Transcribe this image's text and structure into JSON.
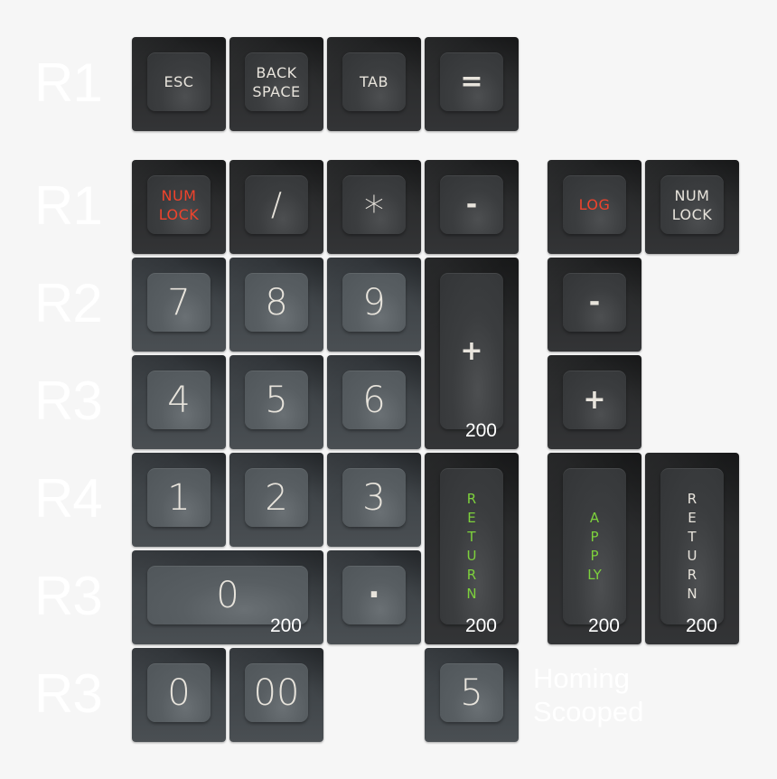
{
  "row_labels": [
    "R1",
    "R1",
    "R2",
    "R3",
    "R4",
    "R3",
    "R3"
  ],
  "colors": {
    "background": "#f6f6f6",
    "legend_default": "#e8e4dc",
    "legend_red": "#f0432c",
    "legend_green": "#7dd13c",
    "keycap_dark": "#2a2b2c",
    "keycap_grey": "#464b4f",
    "label_text": "#ffffff"
  },
  "keys": {
    "esc": {
      "legend": "ESC"
    },
    "backspace": {
      "line1": "BACK",
      "line2": "SPACE"
    },
    "tab": {
      "legend": "TAB"
    },
    "equals": {
      "legend": "="
    },
    "numlock_red": {
      "line1": "NUM",
      "line2": "LOCK"
    },
    "slash": {
      "legend": "/"
    },
    "asterisk": {
      "legend": "*"
    },
    "minus": {
      "legend": "-"
    },
    "log": {
      "legend": "LOG"
    },
    "numlock_white": {
      "line1": "NUM",
      "line2": "LOCK"
    },
    "k7": {
      "legend": "7"
    },
    "k8": {
      "legend": "8"
    },
    "k9": {
      "legend": "9"
    },
    "plus_tall": {
      "legend": "+",
      "size": "200"
    },
    "minus_right": {
      "legend": "-"
    },
    "k4": {
      "legend": "4"
    },
    "k5": {
      "legend": "5"
    },
    "k6": {
      "legend": "6"
    },
    "plus_right": {
      "legend": "+"
    },
    "k1": {
      "legend": "1"
    },
    "k2": {
      "legend": "2"
    },
    "k3": {
      "legend": "3"
    },
    "return_green": {
      "legend": "RETURN",
      "size": "200"
    },
    "apply": {
      "legend": "APPLY",
      "size": "200"
    },
    "return_white": {
      "legend": "RETURN",
      "size": "200"
    },
    "k0_wide": {
      "legend": "0",
      "size": "200"
    },
    "dot": {
      "legend": "·"
    },
    "k0": {
      "legend": "0"
    },
    "k00": {
      "legend": "00"
    },
    "k5_homing": {
      "legend": "5"
    }
  },
  "notes": {
    "homing_line1": "Homing",
    "homing_line2": "Scooped"
  }
}
